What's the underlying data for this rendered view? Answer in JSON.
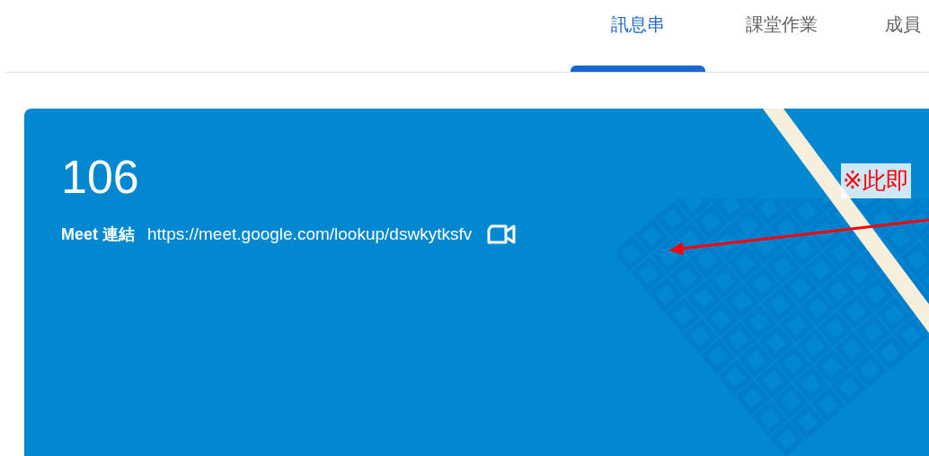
{
  "tabs": [
    {
      "label": "訊息串",
      "selected": true
    },
    {
      "label": "課堂作業",
      "selected": false
    },
    {
      "label": "成員",
      "selected": false
    }
  ],
  "banner": {
    "title": "106",
    "meet_label": "Meet 連結",
    "meet_url": "https://meet.google.com/lookup/dswkytksfv"
  },
  "annotation": {
    "text": "※此即"
  }
}
